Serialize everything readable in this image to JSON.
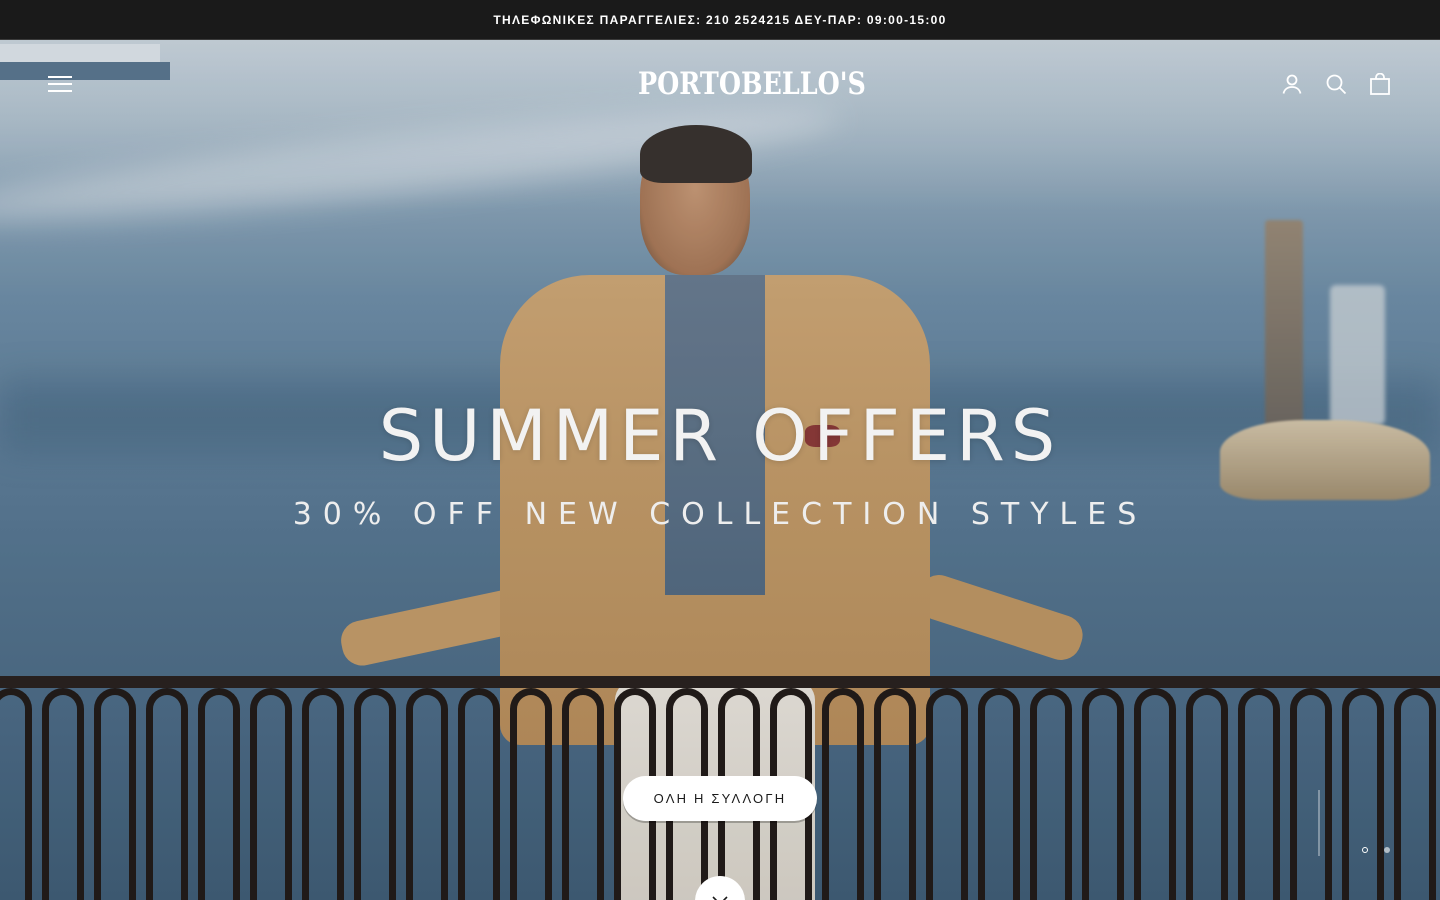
{
  "announcement": {
    "text": "ΤΗΛΕΦΩΝΙΚΕΣ ΠΑΡΑΓΓΕΛΙΕΣ: 210 2524215 ΔΕΥ-ΠΑΡ: 09:00-15:00"
  },
  "header": {
    "logo_text": "PORTOBELLO'S",
    "icons": {
      "menu": "menu-icon",
      "account": "user-icon",
      "search": "search-icon",
      "cart": "shopping-bag-icon"
    }
  },
  "hero": {
    "headline": "SUMMER OFFERS",
    "subline": "30% OFF NEW COLLECTION STYLES",
    "cta_label": "ΟΛΗ Η ΣΥΛΛΟΓΗ",
    "slides": {
      "current": 1,
      "total": 2
    }
  },
  "colors": {
    "announcement_bg": "#1a1a1a",
    "text_light": "#ffffff",
    "cta_bg": "#ffffff",
    "cta_text": "#1a1a1a"
  }
}
